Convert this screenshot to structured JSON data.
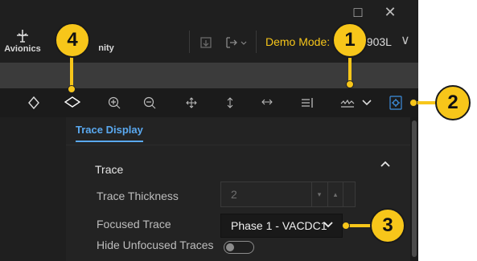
{
  "window": {
    "maximize_icon": "□",
    "close_icon": "✕"
  },
  "nav": {
    "avionics_label": "Avionics",
    "partial_label": "nity"
  },
  "header": {
    "demo_label": "Demo Mode:",
    "instrument": "5903L",
    "dropdown_icon": "∨"
  },
  "toolbar": {
    "icons": [
      "◇",
      "◇",
      "⊕",
      "⊖",
      "✥",
      "↕",
      "↔",
      "⇥",
      "∿",
      "⌄",
      "⚙"
    ]
  },
  "panel": {
    "tab_label": "Trace Display",
    "section_title": "Trace",
    "trace_thickness_label": "Trace Thickness",
    "trace_thickness_value": "2",
    "focused_trace_label": "Focused Trace",
    "focused_trace_value": "Phase 1 - VACDC1",
    "hide_unfocused_label": "Hide Unfocused Traces",
    "hide_unfocused_on": false
  },
  "callouts": [
    "1",
    "2",
    "3",
    "4"
  ],
  "colors": {
    "accent": "#f7c61a",
    "tab_blue": "#5aa9f0",
    "background": "#1f1f1f"
  }
}
